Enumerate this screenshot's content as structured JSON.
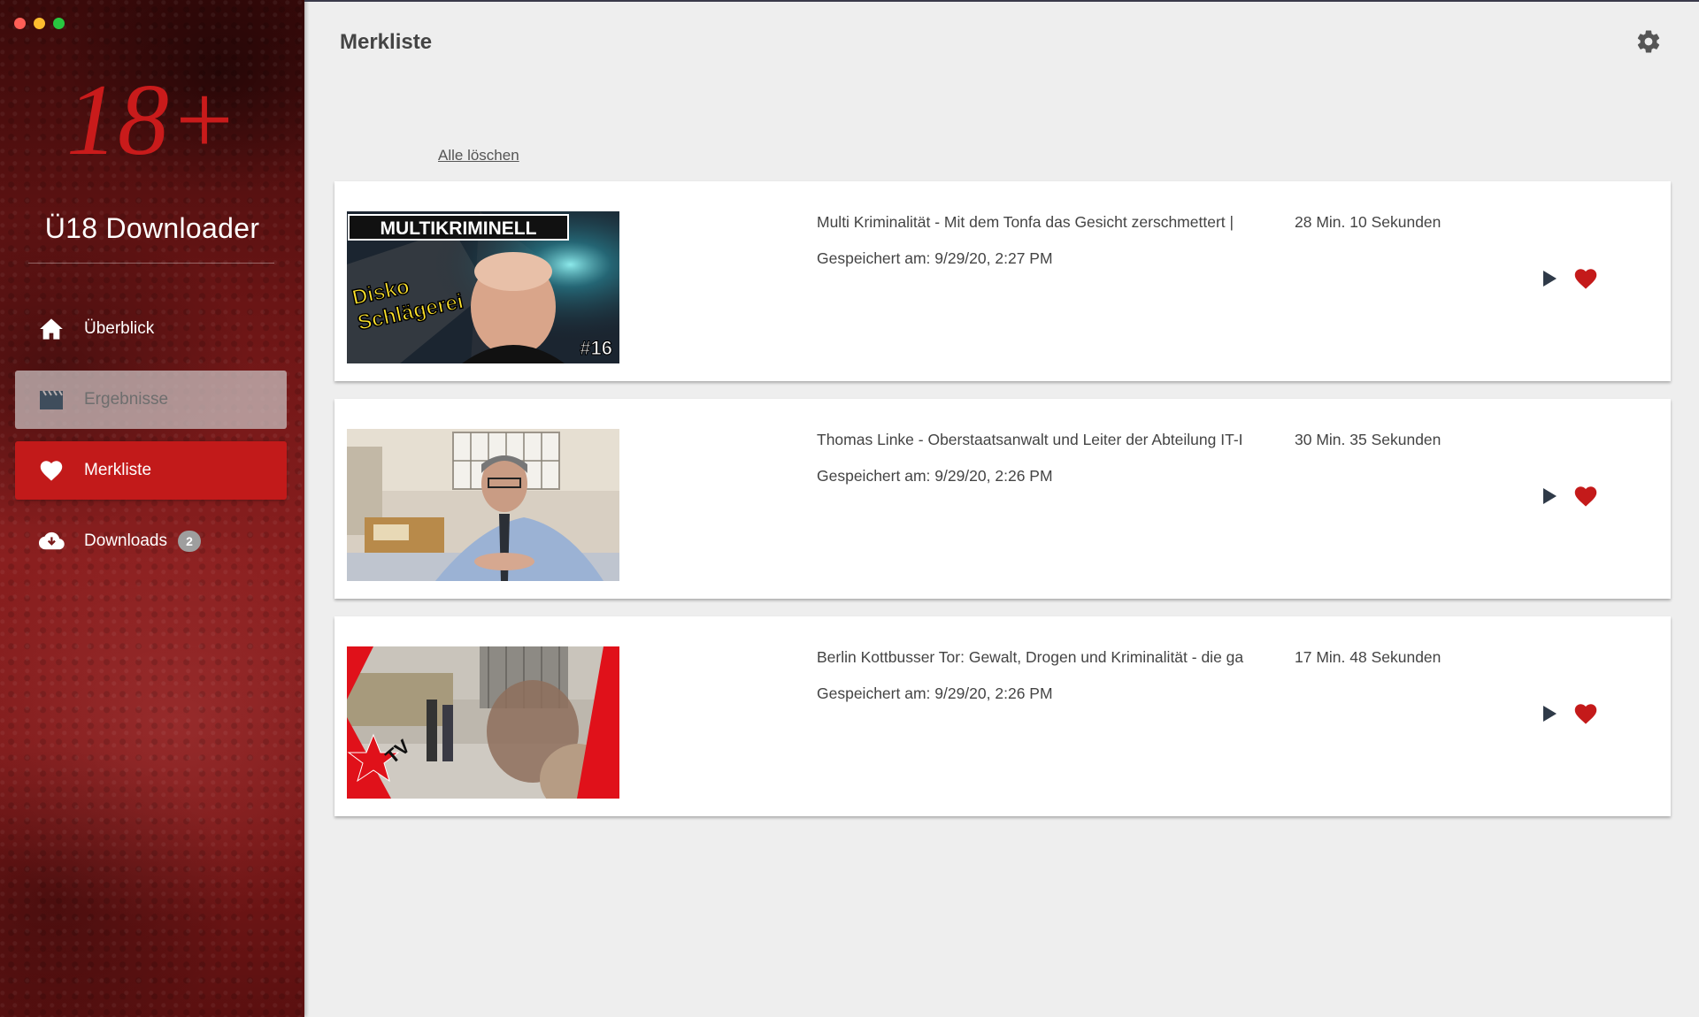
{
  "window": {
    "controls": [
      "close",
      "minimize",
      "zoom"
    ]
  },
  "sidebar": {
    "logo_text": "18+",
    "app_title": "Ü18 Downloader",
    "items": [
      {
        "label": "Überblick",
        "icon": "home-icon",
        "state": "normal"
      },
      {
        "label": "Ergebnisse",
        "icon": "clapperboard-icon",
        "state": "disabled"
      },
      {
        "label": "Merkliste",
        "icon": "heart-icon",
        "state": "active"
      },
      {
        "label": "Downloads",
        "icon": "cloud-download-icon",
        "state": "normal",
        "badge": "2"
      }
    ]
  },
  "header": {
    "title": "Merkliste",
    "settings_icon": "gear-icon"
  },
  "main": {
    "clear_all_label": "Alle löschen",
    "items": [
      {
        "title": "Multi Kriminalität - Mit dem Tonfa das Gesicht zerschmettert |",
        "duration": "28 Min. 10 Sekunden",
        "saved": "Gespeichert am: 9/29/20, 2:27 PM",
        "thumb_text_1": "MULTIKRIMINELL",
        "thumb_text_2": "Disko",
        "thumb_text_3": "Schlägerei",
        "thumb_text_4": "#16"
      },
      {
        "title": "Thomas Linke - Oberstaatsanwalt und Leiter der Abteilung IT-I",
        "duration": "30 Min. 35 Sekunden",
        "saved": "Gespeichert am: 9/29/20, 2:26 PM"
      },
      {
        "title": "Berlin Kottbusser Tor: Gewalt, Drogen und Kriminalität - die ga",
        "duration": "17 Min. 48 Sekunden",
        "saved": "Gespeichert am: 9/29/20, 2:26 PM",
        "thumb_text_1": "TV"
      }
    ]
  },
  "colors": {
    "accent": "#c21a1a",
    "heart": "#c41a1a",
    "play": "#2f3a48",
    "badge": "#9e9e9e",
    "background": "#eeeeee"
  }
}
